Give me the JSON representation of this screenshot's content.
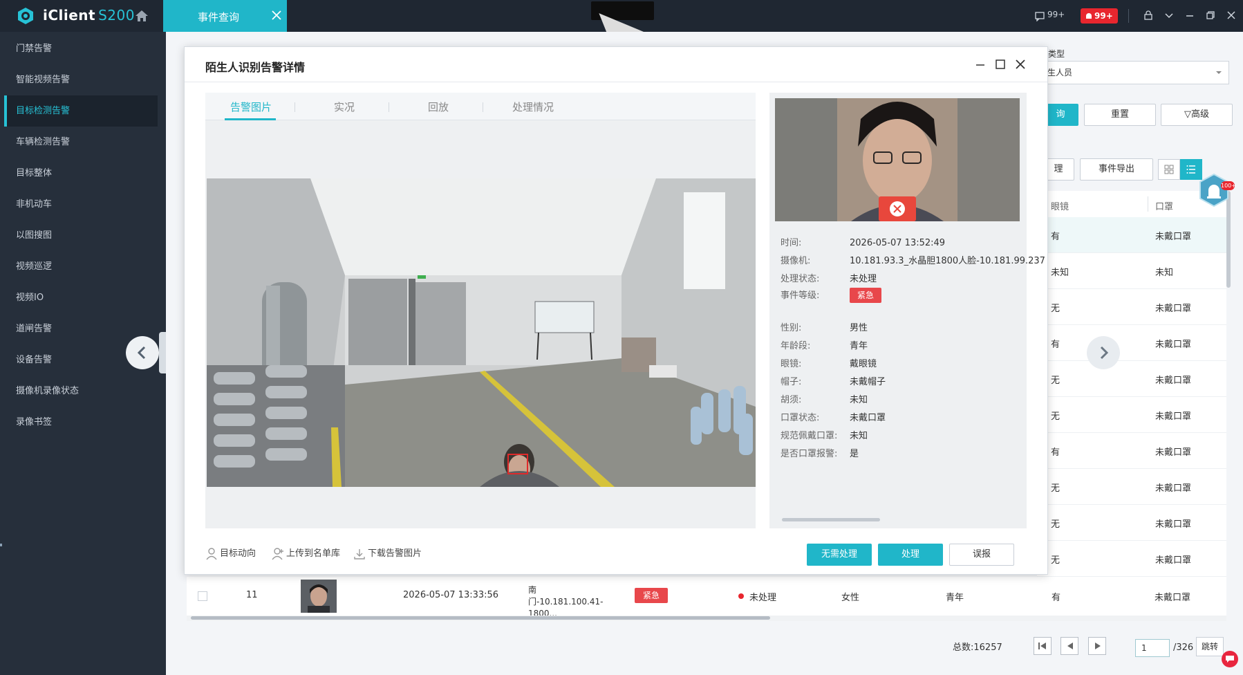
{
  "app": {
    "name": "iClient",
    "model": "S200",
    "active_tab": "事件查询",
    "message_count": "99+",
    "alarm_count": "99+"
  },
  "sidebar": {
    "items": [
      {
        "label": "门禁告警"
      },
      {
        "label": "智能视频告警"
      },
      {
        "label": "目标检测告警",
        "active": true
      },
      {
        "label": "车辆检测告警"
      },
      {
        "label": "目标整体"
      },
      {
        "label": "非机动车"
      },
      {
        "label": "以图搜图"
      },
      {
        "label": "视频巡逻"
      },
      {
        "label": "视频IO"
      },
      {
        "label": "道闸告警"
      },
      {
        "label": "设备告警"
      },
      {
        "label": "摄像机录像状态"
      },
      {
        "label": "录像书签"
      }
    ]
  },
  "filters": {
    "type_label": "类型",
    "type_value": "生人员",
    "query_label": "询",
    "reset_label": "重置",
    "advanced_label": "▽高级"
  },
  "toolbar": {
    "process_label": "理",
    "export_label": "事件导出"
  },
  "fab": {
    "badge": "100+"
  },
  "table": {
    "headers": [
      "眼镜",
      "口罩"
    ],
    "rows": [
      [
        "有",
        "未戴口罩"
      ],
      [
        "未知",
        "未知"
      ],
      [
        "无",
        "未戴口罩"
      ],
      [
        "有",
        "未戴口罩"
      ],
      [
        "无",
        "未戴口罩"
      ],
      [
        "无",
        "未戴口罩"
      ],
      [
        "有",
        "未戴口罩"
      ],
      [
        "无",
        "未戴口罩"
      ],
      [
        "无",
        "未戴口罩"
      ],
      [
        "无",
        "未戴口罩"
      ]
    ],
    "visible_row": {
      "index": "11",
      "time": "2026-05-07 13:33:56",
      "camera_line1": "南",
      "camera_line2": "门-10.181.100.41-1800...",
      "level": "紧急",
      "status": "未处理",
      "sex": "女性",
      "age": "青年",
      "glasses": "有",
      "mask": "未戴口罩"
    }
  },
  "pagination": {
    "total": "总数:16257",
    "page": "1",
    "of": "/326",
    "jump": "跳转"
  },
  "modal": {
    "title": "陌生人识别告警详情",
    "tabs": [
      "告警图片",
      "实况",
      "回放",
      "处理情况"
    ],
    "info": {
      "time_k": "时间:",
      "time_v": "2026-05-07 13:52:49",
      "camera_k": "摄像机:",
      "camera_v": "10.181.93.3_水晶胆1800人脸-10.181.99.237",
      "status_k": "处理状态:",
      "status_v": "未处理",
      "level_k": "事件等级:",
      "level_v": "紧急",
      "sex_k": "性别:",
      "sex_v": "男性",
      "age_k": "年龄段:",
      "age_v": "青年",
      "glasses_k": "眼镜:",
      "glasses_v": "戴眼镜",
      "hat_k": "帽子:",
      "hat_v": "未戴帽子",
      "beard_k": "胡须:",
      "beard_v": "未知",
      "mask_k": "口罩状态:",
      "mask_v": "未戴口罩",
      "mask_std_k": "规范佩戴口罩:",
      "mask_std_v": "未知",
      "mask_alarm_k": "是否口罩报警:",
      "mask_alarm_v": "是"
    },
    "actions": {
      "track": "目标动向",
      "upload": "上传到名单库",
      "download": "下载告警图片",
      "no_need": "无需处理",
      "process": "处理",
      "false_alarm": "误报"
    }
  },
  "colors": {
    "accent": "#20b6c9",
    "sidebar_bg": "#262f3b",
    "topbar_bg": "#1f2732",
    "danger": "#e8474b"
  }
}
